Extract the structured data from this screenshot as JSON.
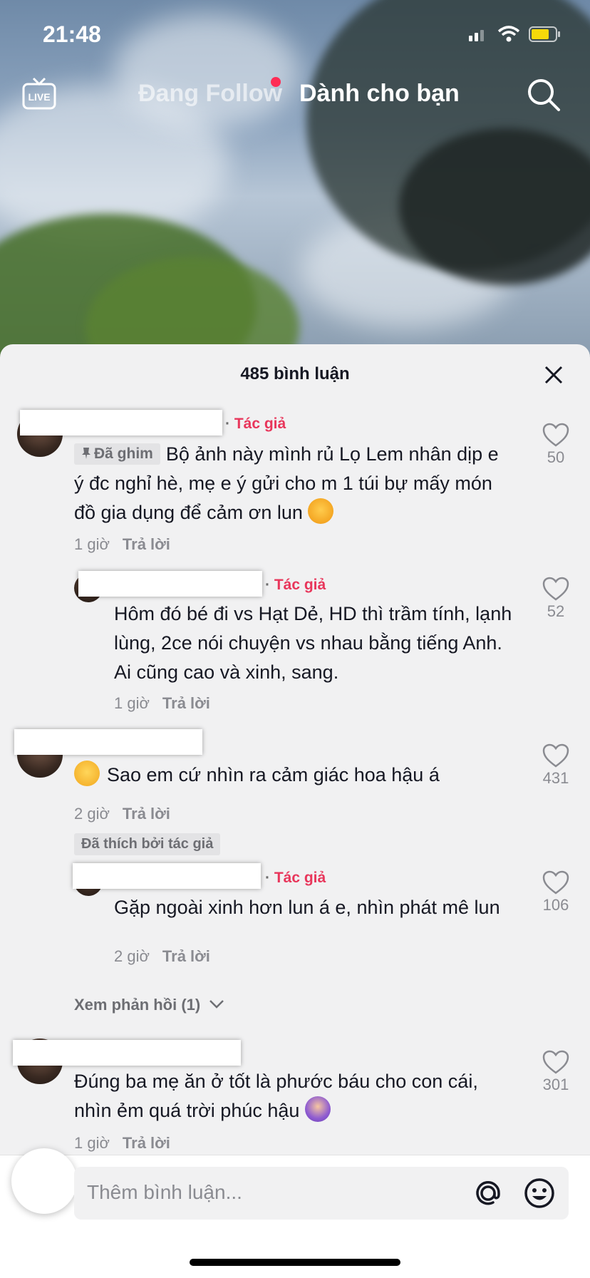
{
  "status_bar": {
    "time": "21:48"
  },
  "top_nav": {
    "live_label": "LIVE",
    "tab_following": "Đang Follow",
    "tab_for_you": "Dành cho bạn"
  },
  "comments_sheet": {
    "title": "485 bình luận",
    "comments": [
      {
        "author_badge": "Tác giả",
        "pinned_label": "Đã ghim",
        "text": "Bộ ảnh này mình rủ Lọ Lem nhân dịp e ý đc nghỉ hè, mẹ e ý gửi cho m 1 túi bự mấy món đồ gia dụng để cảm ơn lun",
        "time": "1 giờ",
        "reply_label": "Trả lời",
        "likes": "50"
      },
      {
        "author_badge": "Tác giả",
        "text": "Hôm đó bé đi vs Hạt Dẻ, HD thì trầm tính, lạnh lùng, 2ce nói chuyện vs nhau bằng tiếng Anh. Ai cũng cao và xinh, sang.",
        "time": "1 giờ",
        "reply_label": "Trả lời",
        "likes": "52"
      },
      {
        "text": "Sao em cứ nhìn ra cảm giác hoa hậu á",
        "time": "2 giờ",
        "reply_label": "Trả lời",
        "liked_by_author": "Đã thích bởi tác giả",
        "likes": "431"
      },
      {
        "author_badge": "Tác giả",
        "text": "Gặp ngoài xinh hơn lun á e, nhìn phát mê lun",
        "time": "2 giờ",
        "reply_label": "Trả lời",
        "likes": "106"
      },
      {
        "view_replies": "Xem phản hồi (1)"
      },
      {
        "text": "Đúng ba mẹ ăn ở tốt là phước báu cho con cái, nhìn ẻm quá trời phúc hậu",
        "time": "1 giờ",
        "reply_label": "Trả lời",
        "likes": "301"
      }
    ]
  },
  "composer": {
    "placeholder": "Thêm bình luận..."
  },
  "colors": {
    "accent": "#fe2c55",
    "author_badge": "#e8365b",
    "sheet_bg": "#f1f1f2"
  }
}
